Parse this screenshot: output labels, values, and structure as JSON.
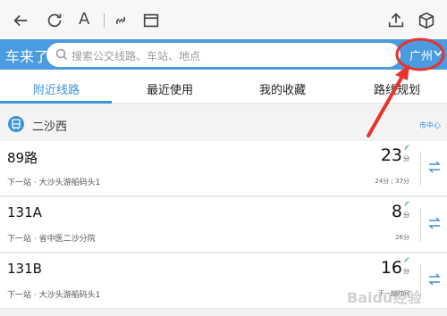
{
  "header": {
    "logo": "车来了",
    "search_placeholder": "搜索公交线路、车站、地点",
    "city": "广州"
  },
  "tabs": [
    {
      "label": "附近线路",
      "active": true
    },
    {
      "label": "最近使用",
      "active": false
    },
    {
      "label": "我的收藏",
      "active": false
    },
    {
      "label": "路线规划",
      "active": false
    }
  ],
  "station": {
    "name": "二沙西",
    "direction": "市中心"
  },
  "routes": [
    {
      "name": "89路",
      "next_stop": "下一站 · 大沙头游船码头1",
      "eta": "23",
      "eta_unit": "分",
      "eta_sub": "24分 ; 37分"
    },
    {
      "name": "131A",
      "next_stop": "下一站 · 省中医二沙分院",
      "eta": "8",
      "eta_unit": "分",
      "eta_sub": "26分"
    },
    {
      "name": "131B",
      "next_stop": "下一站 · 大沙头游船码头1",
      "eta": "16",
      "eta_unit": "分",
      "eta_sub": "下一趟时间"
    }
  ],
  "colors": {
    "accent": "#4a9be0",
    "annotation": "#e8322b"
  },
  "watermark": "Baidu经验"
}
